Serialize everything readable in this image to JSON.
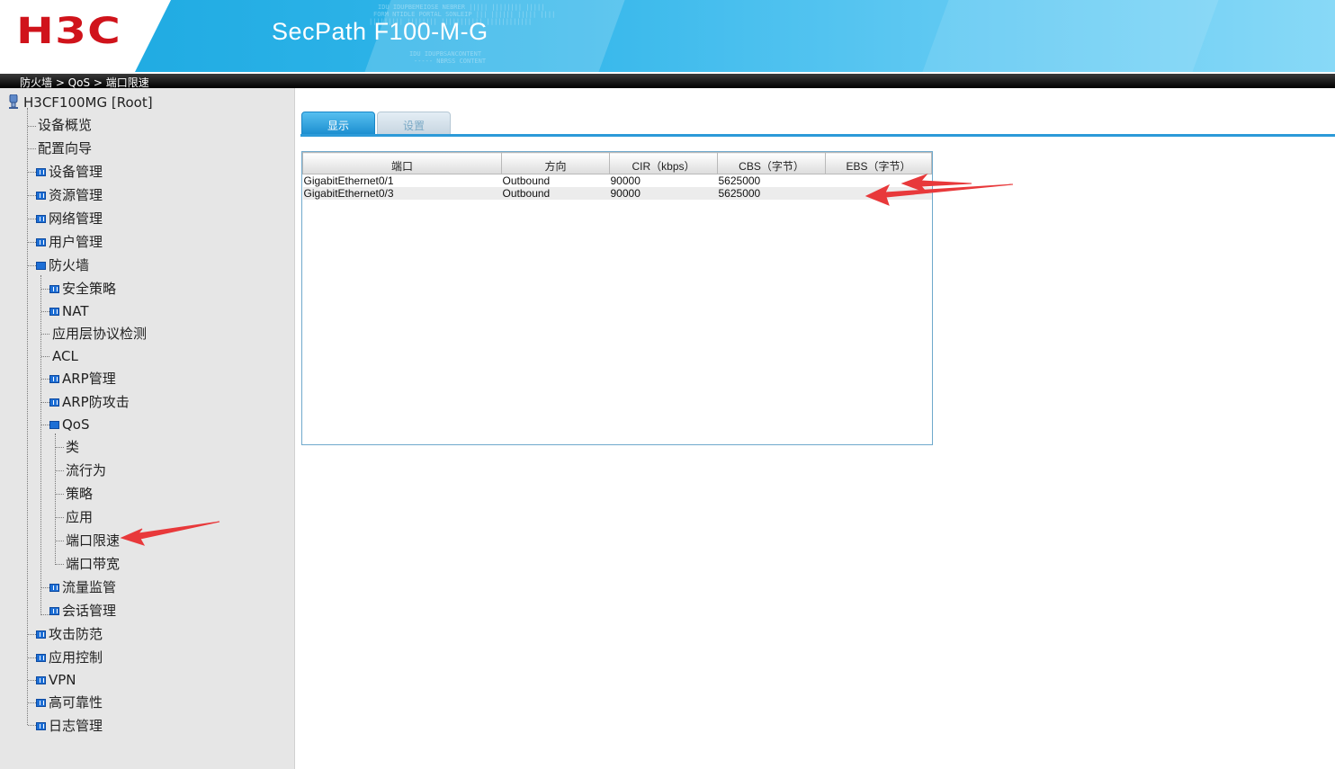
{
  "header": {
    "logo": "H3C",
    "product_title": "SecPath F100-M-G"
  },
  "breadcrumb": "防火墙 > QoS > 端口限速",
  "sidebar": {
    "root": "H3CF100MG [Root]",
    "items": [
      {
        "label": "设备概览"
      },
      {
        "label": "配置向导"
      },
      {
        "label": "设备管理"
      },
      {
        "label": "资源管理"
      },
      {
        "label": "网络管理"
      },
      {
        "label": "用户管理"
      },
      {
        "label": "防火墙"
      },
      {
        "label": "安全策略"
      },
      {
        "label": "NAT"
      },
      {
        "label": "应用层协议检测"
      },
      {
        "label": "ACL"
      },
      {
        "label": "ARP管理"
      },
      {
        "label": "ARP防攻击"
      },
      {
        "label": "QoS"
      },
      {
        "label": "类"
      },
      {
        "label": "流行为"
      },
      {
        "label": "策略"
      },
      {
        "label": "应用"
      },
      {
        "label": "端口限速"
      },
      {
        "label": "端口带宽"
      },
      {
        "label": "流量监管"
      },
      {
        "label": "会话管理"
      },
      {
        "label": "攻击防范"
      },
      {
        "label": "应用控制"
      },
      {
        "label": "VPN"
      },
      {
        "label": "高可靠性"
      },
      {
        "label": "日志管理"
      }
    ]
  },
  "tabs": [
    {
      "label": "显示"
    },
    {
      "label": "设置"
    }
  ],
  "table": {
    "columns": [
      "端口",
      "方向",
      "CIR（kbps）",
      "CBS（字节）",
      "EBS（字节）"
    ],
    "rows": [
      [
        "GigabitEthernet0/1",
        "Outbound",
        "90000",
        "5625000",
        ""
      ],
      [
        "GigabitEthernet0/3",
        "Outbound",
        "90000",
        "5625000",
        ""
      ]
    ]
  },
  "colors": {
    "logo_red": "#d0131b",
    "header_blue": "#1aa8e0",
    "tab_active": "#1d8fd0",
    "annotation_arrow": "#e8393b"
  }
}
